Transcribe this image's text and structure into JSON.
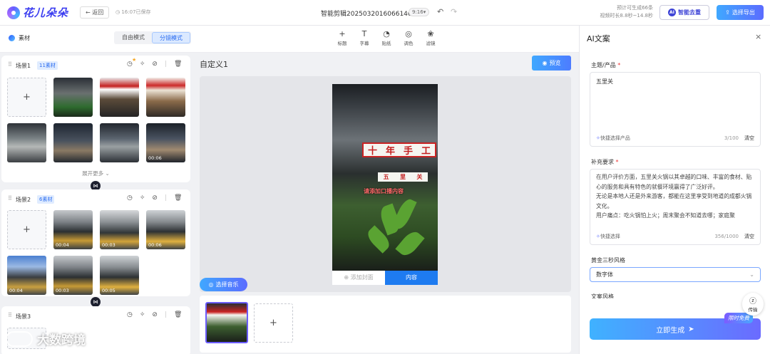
{
  "header": {
    "logo_text": "花儿朵朵",
    "back_label": "返回",
    "save_status": "16:07已保存",
    "doc_title": "智能剪辑2025032016066146",
    "aspect_ratio": "9:16",
    "estimate_count": "预计可生成66条",
    "estimate_duration": "视频时长8.8秒~14.8秒",
    "ai_label": "智能去重",
    "export_label": "选择导出"
  },
  "toolbar": {
    "material_label": "素材",
    "modes": [
      "自由模式",
      "分镜模式"
    ],
    "active_mode": "分镜模式",
    "tools": [
      {
        "icon": "plus-icon",
        "glyph": "+",
        "label": "标题"
      },
      {
        "icon": "text-icon",
        "glyph": "T",
        "label": "字幕"
      },
      {
        "icon": "sticker-icon",
        "glyph": "◔",
        "label": "贴纸"
      },
      {
        "icon": "palette-icon",
        "glyph": "◎",
        "label": "调色"
      },
      {
        "icon": "filter-icon",
        "glyph": "❀",
        "label": "滤镜"
      }
    ]
  },
  "scenes": [
    {
      "title": "场景1",
      "count": "11素材",
      "expand_label": "展开更多",
      "durations": [
        "",
        "",
        "",
        "",
        "",
        "",
        "",
        "00:06"
      ]
    },
    {
      "title": "场景2",
      "count": "6素材",
      "durations": [
        "00:04",
        "00:03",
        "00:06",
        "00:04",
        "00:03",
        "00:05"
      ]
    },
    {
      "title": "场景3"
    }
  ],
  "center": {
    "title": "自定义1",
    "preview_label": "预览",
    "sign_main": [
      "十",
      "年",
      "手",
      "工"
    ],
    "sign_sub": [
      "五",
      "里",
      "关"
    ],
    "overlay_text": "请添加口播内容",
    "tab_cover": "添加封面",
    "tab_content": "内容",
    "music_label": "选择音乐"
  },
  "ai_panel": {
    "title": "AI文案",
    "topic_label": "主题/产品",
    "topic_value": "五里关",
    "topic_quick": "快捷选择产品",
    "topic_count": "3/100",
    "clear_label": "清空",
    "supplement_label": "补充要求",
    "supplement_text": [
      "在用户评价方面，五里关火锅以其卓越的口味、丰富的食材、贴心的服务和具有特色的就餐环境赢得了广泛好评。",
      "无论是本地人还是外来游客，都能在这里享受到地道的成都火锅文化。",
      "用户痛点：吃火锅怕上火；周末聚会不知道去哪；家庭聚"
    ],
    "supplement_quick": "快捷选择",
    "supplement_count": "356/1000",
    "style_label": "黄金三秒风格",
    "style_value": "数字体",
    "next_label": "文案风格",
    "generate_label": "立即生成",
    "limited_badge": "限时免费",
    "transfer_label": "传输"
  },
  "watermark": {
    "text": "大数跨境"
  }
}
